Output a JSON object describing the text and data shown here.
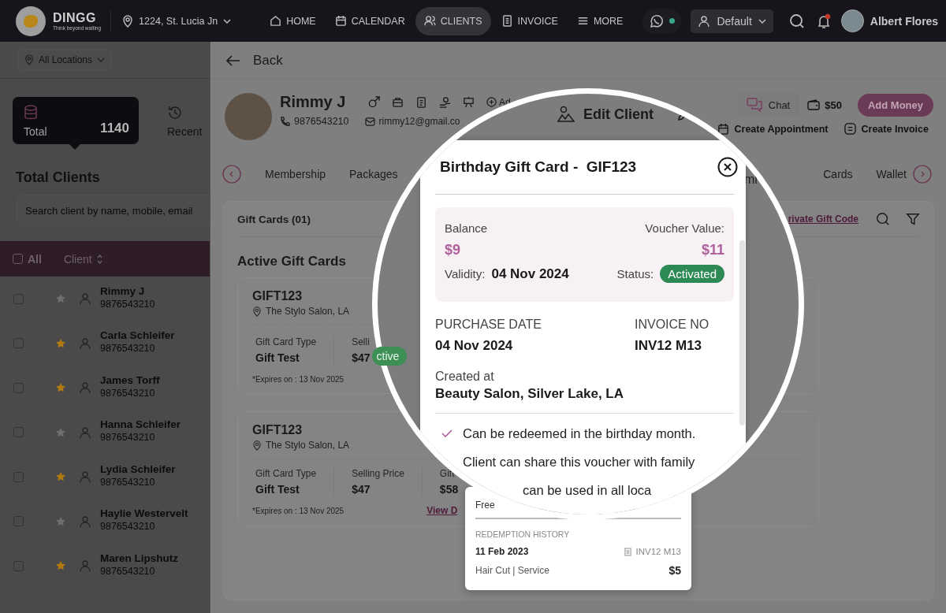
{
  "topbar": {
    "brand": "DINGG",
    "tagline": "Think beyond waiting",
    "location": "1224, St. Lucia Jn",
    "nav": [
      {
        "label": "HOME",
        "selected": false
      },
      {
        "label": "CALENDAR",
        "selected": false
      },
      {
        "label": "CLIENTS",
        "selected": true
      },
      {
        "label": "INVOICE",
        "selected": false
      },
      {
        "label": "MORE",
        "selected": false
      }
    ],
    "whatsapp_online": true,
    "profile": "Default",
    "notifications_unread": true,
    "user": "Albert Flores"
  },
  "sidebar": {
    "location_filter": "All Locations",
    "stats": [
      {
        "label": "Total",
        "count": "1140",
        "selected": true
      },
      {
        "label": "Recent",
        "selected": false
      }
    ],
    "title": "Total Clients",
    "search": {
      "placeholder": "Search client by name, mobile, email"
    },
    "columns": {
      "select_all": "All",
      "all_checked": false,
      "client": "Client"
    },
    "clients": [
      {
        "name": "Rimmy J",
        "phone": "9876543210",
        "starred": false,
        "checked": false
      },
      {
        "name": "Carla Schleifer",
        "phone": "9876543210",
        "starred": true,
        "checked": false
      },
      {
        "name": "James Torff",
        "phone": "9876543210",
        "starred": true,
        "checked": false
      },
      {
        "name": "Hanna Schleifer",
        "phone": "9876543210",
        "starred": false,
        "checked": false
      },
      {
        "name": "Lydia Schleifer",
        "phone": "9876543210",
        "starred": true,
        "checked": false
      },
      {
        "name": "Haylie Westervelt",
        "phone": "9876543210",
        "starred": false,
        "checked": false
      },
      {
        "name": "Maren Lipshutz",
        "phone": "9876543210",
        "starred": true,
        "checked": false
      }
    ]
  },
  "client": {
    "back": "Back",
    "name": "Rimmy J",
    "phone": "9876543210",
    "email": "rimmy12@gmail.co",
    "add_fragment": "Ad",
    "chat": "Chat",
    "wallet": "$50",
    "add_money": "Add Money",
    "create_appointment": "Create Appointment",
    "create_invoice": "Create Invoice"
  },
  "tabs": {
    "left": [
      {
        "label": "Membership",
        "selected": false
      },
      {
        "label": "Packages",
        "selected": false
      }
    ],
    "right": [
      {
        "label": "Cards",
        "selected": false
      },
      {
        "label": "Wallet",
        "selected": false
      }
    ]
  },
  "gift_cards": {
    "title": "Gift Cards (01)",
    "private_code_link": "rivate Gift Code",
    "heading": "Active Gift Cards",
    "cards": [
      {
        "code": "GIFT123",
        "location": "The Stylo Salon, LA",
        "fields": [
          {
            "label": "Gift Card Type",
            "value": "Gift Test"
          },
          {
            "label": "Selli",
            "value": "$47"
          }
        ],
        "status": "ctive",
        "expires": "*Expires on : 13 Nov 2025"
      },
      {
        "code": "GIFT123",
        "location": "The Stylo Salon, LA",
        "fields": [
          {
            "label": "Gift Card Type",
            "value": "Gift Test"
          },
          {
            "label": "Selling Price",
            "value": "$47"
          },
          {
            "label": "Gift",
            "value": "$58"
          }
        ],
        "link": "View D",
        "expires": "*Expires on : 13 Nov 2025"
      }
    ]
  },
  "magnifier": {
    "edit": "Edit Client",
    "tab_fragment": "mi",
    "modal": {
      "title": "Birthday Gift Card -",
      "code": "GIF123",
      "balance_label": "Balance",
      "balance": "$9",
      "voucher_label": "Voucher Value:",
      "voucher_value": "$11",
      "validity_label": "Validity:",
      "validity": "04 Nov 2024",
      "status_label": "Status:",
      "status": "Activated",
      "purchase_label": "PURCHASE DATE",
      "purchase_date": "04 Nov 2024",
      "invoice_label": "INVOICE NO",
      "invoice_no": "INV12 M13",
      "created_label": "Created at",
      "created_at": "Beauty Salon, Silver Lake, LA",
      "terms": [
        {
          "kind": "check",
          "text": "Can be redeemed in the birthday month."
        },
        {
          "kind": "plain",
          "text": "Client can share this voucher with family"
        },
        {
          "kind": "continued",
          "text": "can be used in all loca"
        }
      ]
    }
  },
  "redemption_card": {
    "top_fragment": "Free",
    "section": "REDEMPTION HISTORY",
    "date": "11 Feb 2023",
    "invoice": "INV12 M13",
    "service": "Hair Cut | Service",
    "amount": "$5"
  }
}
